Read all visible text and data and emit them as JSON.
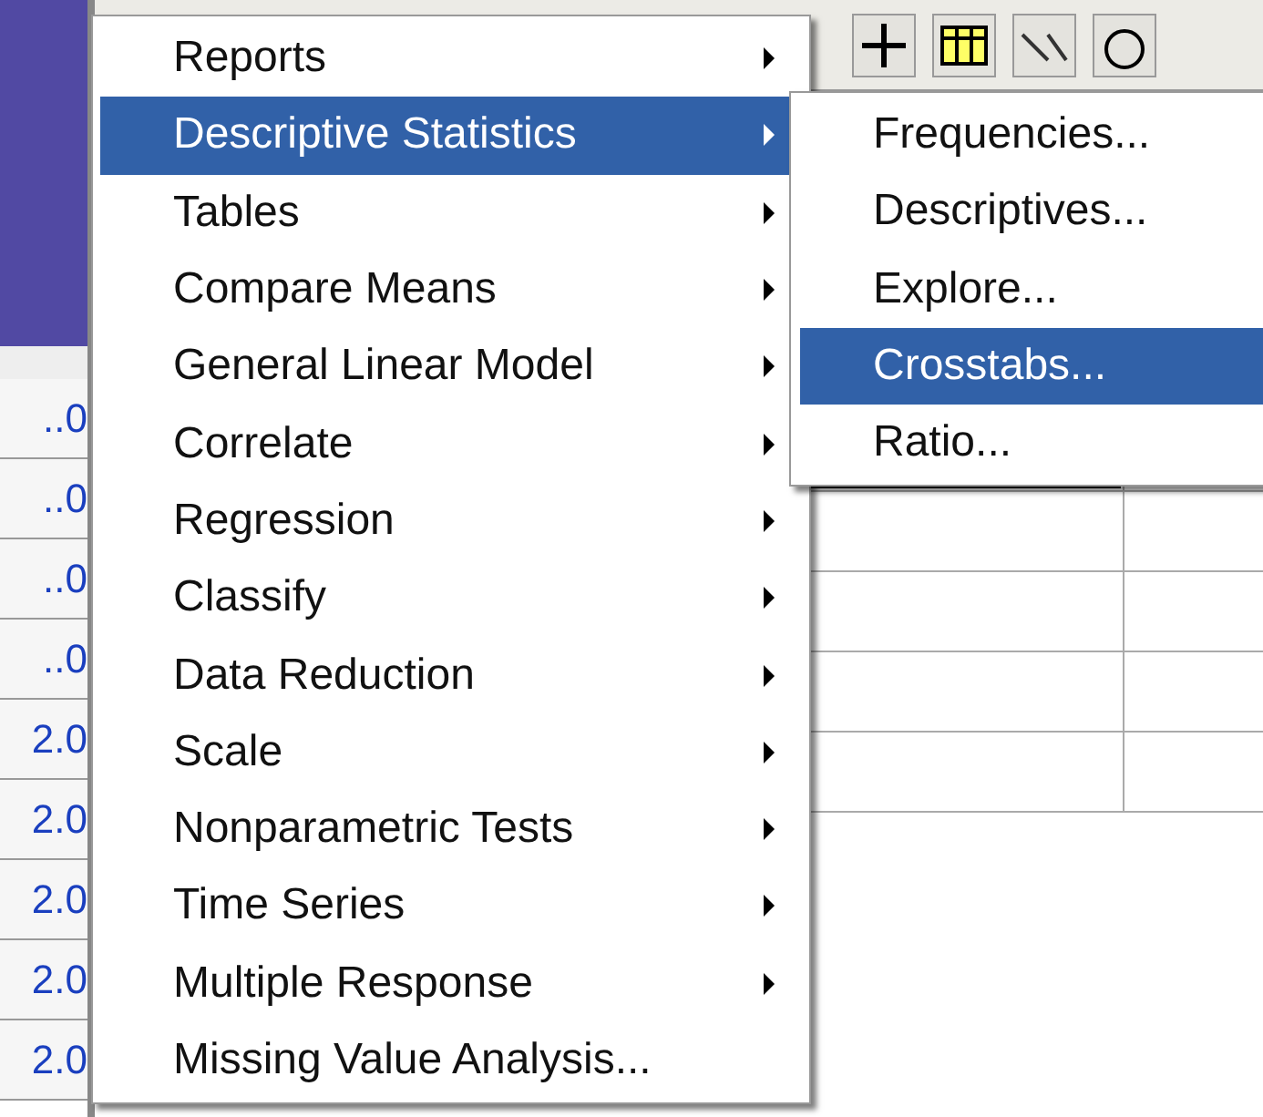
{
  "grid": {
    "cells": [
      "..0",
      "..0",
      "..0",
      "..0",
      "2.0",
      "2.0",
      "2.0",
      "2.0",
      "2.0"
    ]
  },
  "menu": {
    "items": [
      {
        "label": "Reports",
        "has_submenu": true,
        "selected": false
      },
      {
        "label": "Descriptive Statistics",
        "has_submenu": true,
        "selected": true
      },
      {
        "label": "Tables",
        "has_submenu": true,
        "selected": false
      },
      {
        "label": "Compare Means",
        "has_submenu": true,
        "selected": false
      },
      {
        "label": "General Linear Model",
        "has_submenu": true,
        "selected": false
      },
      {
        "label": "Correlate",
        "has_submenu": true,
        "selected": false
      },
      {
        "label": "Regression",
        "has_submenu": true,
        "selected": false
      },
      {
        "label": "Classify",
        "has_submenu": true,
        "selected": false
      },
      {
        "label": "Data Reduction",
        "has_submenu": true,
        "selected": false
      },
      {
        "label": "Scale",
        "has_submenu": true,
        "selected": false
      },
      {
        "label": "Nonparametric Tests",
        "has_submenu": true,
        "selected": false
      },
      {
        "label": "Time Series",
        "has_submenu": true,
        "selected": false
      },
      {
        "label": "Multiple Response",
        "has_submenu": true,
        "selected": false
      },
      {
        "label": "Missing Value Analysis...",
        "has_submenu": false,
        "selected": false
      }
    ]
  },
  "submenu": {
    "items": [
      {
        "label": "Frequencies...",
        "selected": false
      },
      {
        "label": "Descriptives...",
        "selected": false
      },
      {
        "label": "Explore...",
        "selected": false
      },
      {
        "label": "Crosstabs...",
        "selected": true
      },
      {
        "label": "Ratio...",
        "selected": false
      }
    ]
  }
}
